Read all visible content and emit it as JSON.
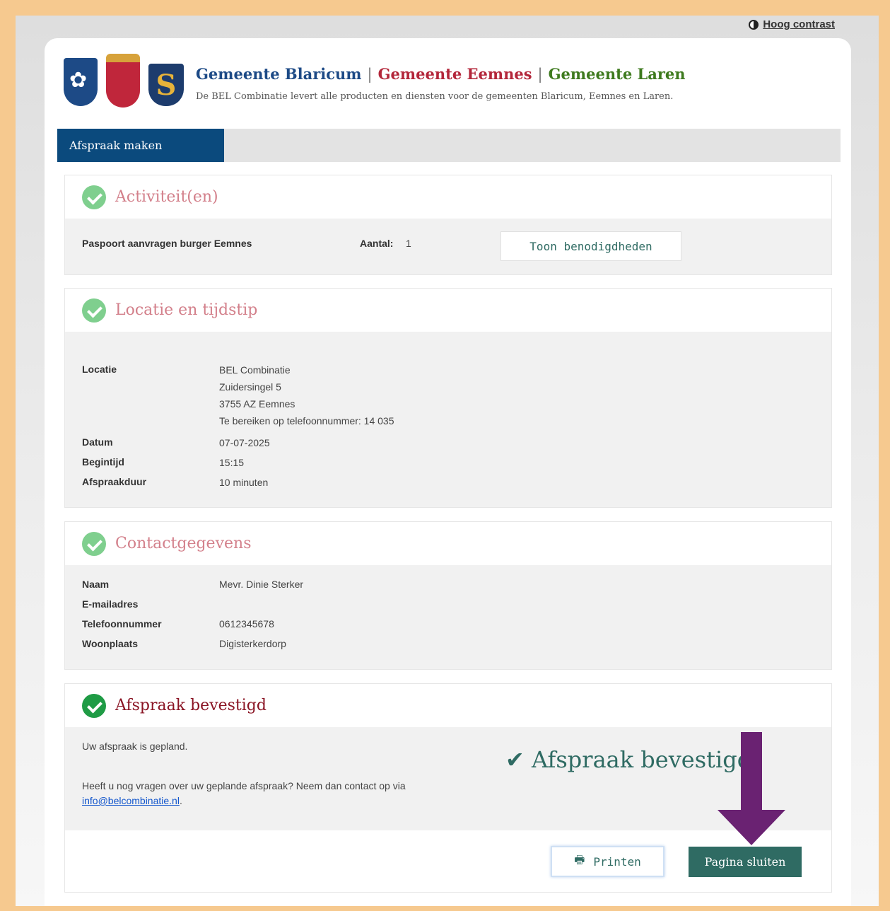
{
  "top": {
    "contrast_label": "Hoog contrast"
  },
  "header": {
    "municipalities": [
      "Gemeente Blaricum",
      "Gemeente Eemnes",
      "Gemeente Laren"
    ],
    "separator": "|",
    "logo_letter": "S",
    "tagline": "De BEL Combinatie levert alle producten en diensten voor de gemeenten Blaricum, Eemnes en Laren."
  },
  "nav": {
    "tab": "Afspraak maken"
  },
  "activities": {
    "title": "Activiteit(en)",
    "item": "Paspoort aanvragen burger Eemnes",
    "count_label": "Aantal:",
    "count": "1",
    "button": "Toon benodigdheden"
  },
  "location": {
    "title": "Locatie en tijdstip",
    "rows": [
      {
        "label": "Locatie",
        "lines": [
          "BEL Combinatie",
          "Zuidersingel 5",
          "3755 AZ Eemnes",
          "Te bereiken op telefoonnummer: 14 035"
        ]
      },
      {
        "label": "Datum",
        "value": "07-07-2025"
      },
      {
        "label": "Begintijd",
        "value": "15:15"
      },
      {
        "label": "Afspraakduur",
        "value": "10 minuten"
      }
    ]
  },
  "contact": {
    "title": "Contactgegevens",
    "rows": [
      {
        "label": "Naam",
        "value": "Mevr. Dinie Sterker"
      },
      {
        "label": "E-mailadres",
        "value": ""
      },
      {
        "label": "Telefoonnummer",
        "value": "0612345678"
      },
      {
        "label": "Woonplaats",
        "value": "Digisterkerdorp"
      }
    ]
  },
  "confirmation": {
    "title": "Afspraak bevestigd",
    "planned": "Uw afspraak is gepland.",
    "question": "Heeft u nog vragen over uw geplande afspraak? Neem dan contact op via",
    "email": "info@belcombinatie.nl",
    "period": ".",
    "badge": "Afspraak bevestigd"
  },
  "footer": {
    "print": "Printen",
    "close": "Pagina sluiten"
  },
  "colors": {
    "primary": "#0b4a7d",
    "accent": "#2f6b63",
    "arrow": "#6a2272",
    "check": "#7fcf8e"
  }
}
